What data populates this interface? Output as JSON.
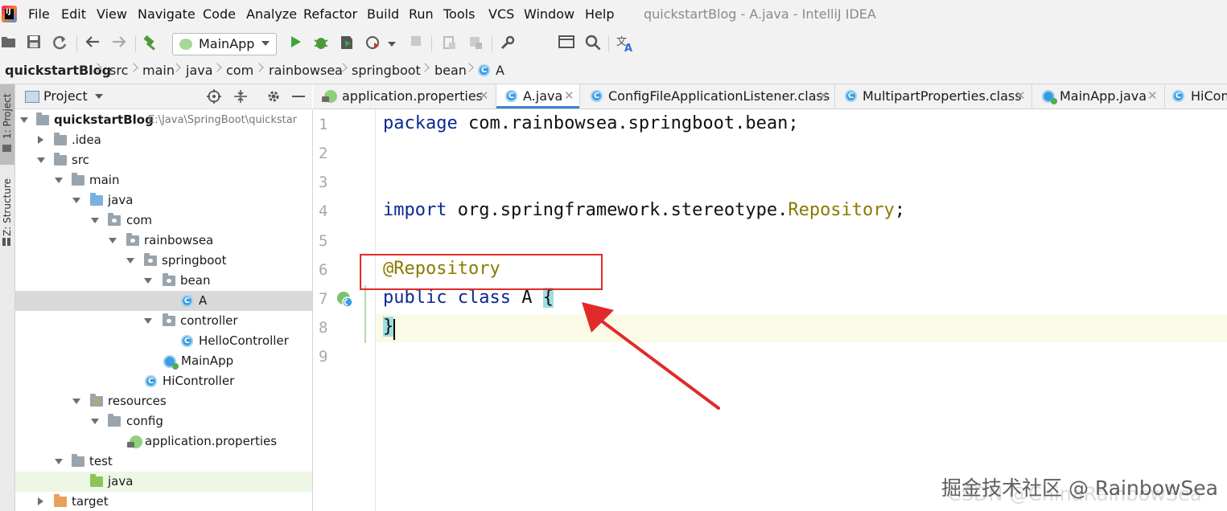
{
  "app": {
    "window_title": "quickstartBlog - A.java - IntelliJ IDEA"
  },
  "menu": [
    {
      "label": "File"
    },
    {
      "label": "Edit"
    },
    {
      "label": "View"
    },
    {
      "label": "Navigate"
    },
    {
      "label": "Code"
    },
    {
      "label": "Analyze"
    },
    {
      "label": "Refactor"
    },
    {
      "label": "Build"
    },
    {
      "label": "Run"
    },
    {
      "label": "Tools"
    },
    {
      "label": "VCS"
    },
    {
      "label": "Window"
    },
    {
      "label": "Help"
    }
  ],
  "toolbar": {
    "run_config": "MainApp",
    "icons": [
      "open-icon",
      "save-icon",
      "sync-icon",
      "back-icon",
      "forward-icon",
      "build-hammer-icon",
      "run-icon",
      "debug-icon",
      "coverage-icon",
      "profile-icon",
      "stop-icon",
      "project-structure-icon",
      "sdk-icon",
      "settings-wrench-icon",
      "terminal-icon",
      "search-icon",
      "translate-icon"
    ]
  },
  "breadcrumb": [
    "quickstartBlog",
    "src",
    "main",
    "java",
    "com",
    "rainbowsea",
    "springboot",
    "bean",
    "A"
  ],
  "side_tools": {
    "project": "1: Project",
    "structure": "Z: Structure"
  },
  "project_panel": {
    "title": "Project",
    "tree": [
      {
        "label": "quickstartBlog",
        "path": "E:\\Java\\SpringBoot\\quickstar"
      },
      {
        "label": ".idea"
      },
      {
        "label": "src"
      },
      {
        "label": "main"
      },
      {
        "label": "java"
      },
      {
        "label": "com"
      },
      {
        "label": "rainbowsea"
      },
      {
        "label": "springboot"
      },
      {
        "label": "bean"
      },
      {
        "label": "A"
      },
      {
        "label": "controller"
      },
      {
        "label": "HelloController"
      },
      {
        "label": "MainApp"
      },
      {
        "label": "HiController"
      },
      {
        "label": "resources"
      },
      {
        "label": "config"
      },
      {
        "label": "application.properties"
      },
      {
        "label": "test"
      },
      {
        "label": "java"
      },
      {
        "label": "target"
      }
    ]
  },
  "tabs": [
    {
      "label": "application.properties"
    },
    {
      "label": "A.java",
      "active": true
    },
    {
      "label": "ConfigFileApplicationListener.class"
    },
    {
      "label": "MultipartProperties.class"
    },
    {
      "label": "MainApp.java"
    },
    {
      "label": "HiCon"
    }
  ],
  "editor": {
    "line_numbers": [
      "1",
      "2",
      "3",
      "4",
      "5",
      "6",
      "7",
      "8",
      "9"
    ],
    "lines": {
      "l1_kw": "package",
      "l1_rest": " com.rainbowsea.springboot.bean;",
      "l4_kw": "import",
      "l4_rest": " org.springframework.stereotype.",
      "l4_cls": "Repository",
      "l4_end": ";",
      "l6_annot": "@Repository",
      "l7_kw": "public class",
      "l7_rest": " A ",
      "l7_brace": "{",
      "l8_brace": "}"
    }
  },
  "watermark": {
    "text": "掘金技术社区 @ RainbowSea",
    "shadow": "CSDN @ChinaRainbowSea"
  },
  "colors": {
    "keyword": "#0b2a8f",
    "annotation": "#8a7a00",
    "highlight_box": "#e02b2b",
    "active_tab_underline": "#4083c9"
  }
}
